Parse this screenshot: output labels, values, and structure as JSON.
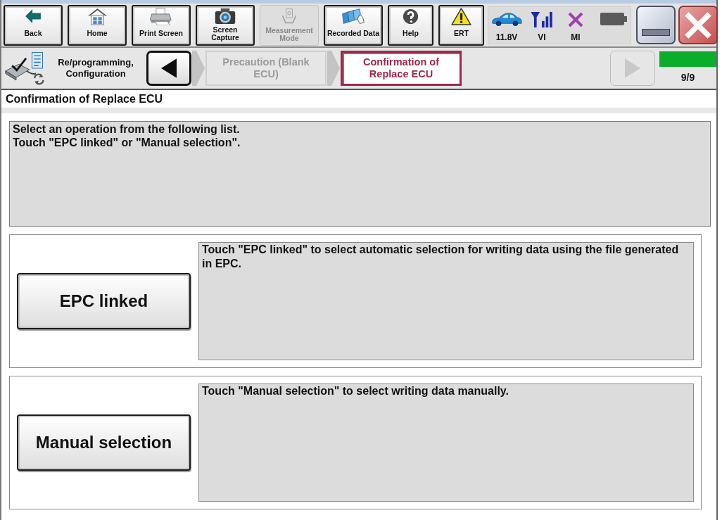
{
  "toolbar": {
    "buttons": [
      {
        "label": "Back",
        "disabled": false
      },
      {
        "label": "Home",
        "disabled": false
      },
      {
        "label": "Print Screen",
        "disabled": false
      },
      {
        "label": "Screen Capture",
        "disabled": false
      },
      {
        "label": "Measurement Mode",
        "disabled": true
      },
      {
        "label": "Recorded Data",
        "disabled": false
      },
      {
        "label": "Help",
        "disabled": false
      },
      {
        "label": "ERT",
        "disabled": false
      }
    ],
    "status": [
      {
        "label": "11.8V"
      },
      {
        "label": "VI"
      },
      {
        "label": "MI"
      }
    ]
  },
  "nav": {
    "section": "Re/programming, Configuration",
    "back": {
      "disabled": false
    },
    "steps": [
      {
        "label": "Precaution (Blank ECU)",
        "selected": false
      },
      {
        "label": "Confirmation of Replace ECU",
        "selected": true
      }
    ],
    "next": {
      "disabled": true
    },
    "progress": {
      "level": 1,
      "reading": "9/9"
    }
  },
  "page_title": "Confirmation of Replace ECU",
  "message": [
    "Select an operation from the following list.",
    "Touch \"EPC linked\" or \"Manual selection\"."
  ],
  "options": [
    {
      "button": "EPC linked",
      "description": "Touch \"EPC linked\" to select automatic selection for writing data using the file generated in EPC."
    },
    {
      "button": "Manual selection",
      "description": "Touch \"Manual selection\" to select writing data manually."
    }
  ]
}
